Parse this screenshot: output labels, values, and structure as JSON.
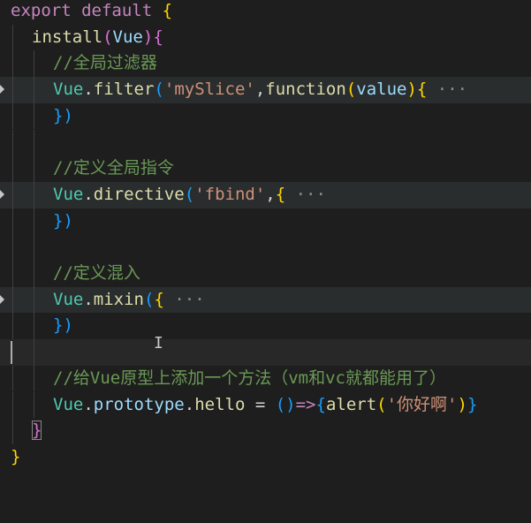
{
  "editor": {
    "lines": {
      "l1": {
        "a": "export",
        "b": " ",
        "c": "default",
        "d": " ",
        "e": "{"
      },
      "l2": {
        "a": "install",
        "b": "(",
        "c": "Vue",
        "d": ")",
        "e": "{"
      },
      "l3": {
        "a": "//全局过滤器"
      },
      "l4": {
        "a": "Vue",
        "b": ".",
        "c": "filter",
        "d": "(",
        "e": "'mySlice'",
        "f": ",",
        "g": "function",
        "h": "(",
        "i": "value",
        "j": ")",
        "k": "{",
        "l": " ···"
      },
      "l5": {
        "a": "})"
      },
      "l7": {
        "a": "//定义全局指令"
      },
      "l8": {
        "a": "Vue",
        "b": ".",
        "c": "directive",
        "d": "(",
        "e": "'fbind'",
        "f": ",",
        "g": "{",
        "h": " ···"
      },
      "l9": {
        "a": "})"
      },
      "l11": {
        "a": "//定义混入"
      },
      "l12": {
        "a": "Vue",
        "b": ".",
        "c": "mixin",
        "d": "(",
        "e": "{",
        "f": " ···"
      },
      "l13": {
        "a": "})"
      },
      "l15": {
        "a": "//给Vue原型上添加一个方法（vm和vc就都能用了）"
      },
      "l16": {
        "a": "Vue",
        "b": ".",
        "c": "prototype",
        "d": ".",
        "e": "hello",
        "f": " = ",
        "g": "()",
        "h": "=>",
        "i": "{",
        "j": "alert",
        "k": "(",
        "l": "'你好啊'",
        "m": ")",
        "n": "}"
      },
      "l17": {
        "a": "}"
      },
      "l18": {
        "a": "}"
      }
    },
    "text_cursor_glyph": "I"
  },
  "colors": {
    "background": "#1e1e1e",
    "keyword": "#c586c0",
    "function": "#dcdcaa",
    "object": "#4ec9b0",
    "string": "#ce9178",
    "comment": "#6a9955",
    "parameter": "#9cdcfe",
    "bracket_level_1": "#ffd700",
    "bracket_level_2": "#da70d6",
    "bracket_level_3": "#179fff"
  }
}
